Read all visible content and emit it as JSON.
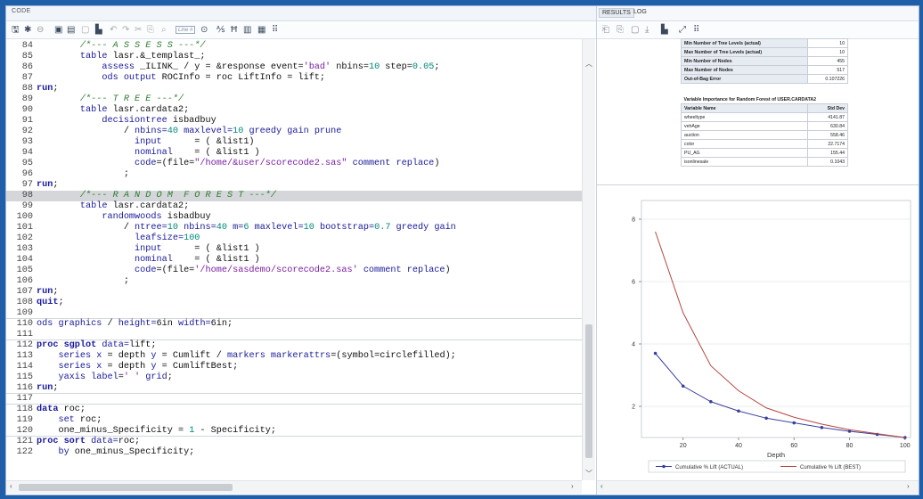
{
  "code_panel": {
    "tab_label": "CODE",
    "toolbar_icons": [
      "save-icon",
      "save-as-icon",
      "copy-icon",
      "print-icon",
      "undo-icon",
      "redo-icon",
      "run-icon",
      "stop-icon",
      "format-icon",
      "snippets-icon",
      "settings-icon"
    ],
    "line_box_label": "Line #",
    "lines": [
      {
        "n": "84",
        "t": [
          [
            "cm",
            "        /*--- A S S E S S ---*/"
          ]
        ]
      },
      {
        "n": "85",
        "t": [
          [
            "kw2",
            "        table "
          ],
          [
            "txt",
            "lasr.&_templast_;"
          ]
        ]
      },
      {
        "n": "86",
        "t": [
          [
            "kw2",
            "            assess "
          ],
          [
            "txt",
            "_ILINK_ / y = &response event="
          ],
          [
            "str",
            "'bad'"
          ],
          [
            "txt",
            " nbins="
          ],
          [
            "num",
            "10"
          ],
          [
            "txt",
            " step="
          ],
          [
            "num",
            "0.05"
          ],
          [
            "txt",
            ";"
          ]
        ]
      },
      {
        "n": "87",
        "t": [
          [
            "kw2",
            "            ods output "
          ],
          [
            "txt",
            "ROCInfo = roc LiftInfo = lift;"
          ]
        ]
      },
      {
        "n": "88",
        "t": [
          [
            "kw",
            "run"
          ],
          [
            "txt",
            ";"
          ]
        ]
      },
      {
        "n": "89",
        "t": [
          [
            "cm",
            "        /*--- T R E E ---*/"
          ]
        ]
      },
      {
        "n": "90",
        "t": [
          [
            "kw2",
            "        table "
          ],
          [
            "txt",
            "lasr.cardata2;"
          ]
        ]
      },
      {
        "n": "91",
        "t": [
          [
            "kw2",
            "            decisiontree "
          ],
          [
            "txt",
            "isbadbuy"
          ]
        ]
      },
      {
        "n": "92",
        "t": [
          [
            "txt",
            "                / "
          ],
          [
            "kw2",
            "nbins="
          ],
          [
            "num",
            "40"
          ],
          [
            "kw2",
            " maxlevel="
          ],
          [
            "num",
            "10"
          ],
          [
            "kw2",
            " greedy gain prune"
          ]
        ]
      },
      {
        "n": "93",
        "t": [
          [
            "kw2",
            "                  input      "
          ],
          [
            "txt",
            "= ( &list1)"
          ]
        ]
      },
      {
        "n": "94",
        "t": [
          [
            "kw2",
            "                  nominal    "
          ],
          [
            "txt",
            "= ( &list1 )"
          ]
        ]
      },
      {
        "n": "95",
        "t": [
          [
            "kw2",
            "                  code"
          ],
          [
            "txt",
            "=(file="
          ],
          [
            "str",
            "\"/home/&user/scorecode2.sas\""
          ],
          [
            "kw2",
            " comment replace"
          ],
          [
            "txt",
            ")"
          ]
        ]
      },
      {
        "n": "96",
        "t": [
          [
            "txt",
            "                ;"
          ]
        ]
      },
      {
        "n": "97",
        "t": [
          [
            "kw",
            "run"
          ],
          [
            "txt",
            ";"
          ]
        ]
      },
      {
        "n": "98",
        "t": [
          [
            "cm",
            "        /*--- R A N D O M  F O R E S T ---*/"
          ]
        ],
        "hl": true
      },
      {
        "n": "99",
        "t": [
          [
            "kw2",
            "        table "
          ],
          [
            "txt",
            "lasr.cardata2;"
          ]
        ]
      },
      {
        "n": "100",
        "t": [
          [
            "kw2",
            "            randomwoods "
          ],
          [
            "txt",
            "isbadbuy"
          ]
        ]
      },
      {
        "n": "101",
        "t": [
          [
            "txt",
            "                / "
          ],
          [
            "kw2",
            "ntree="
          ],
          [
            "num",
            "10"
          ],
          [
            "kw2",
            " nbins="
          ],
          [
            "num",
            "40"
          ],
          [
            "kw2",
            " m="
          ],
          [
            "num",
            "6"
          ],
          [
            "kw2",
            " maxlevel="
          ],
          [
            "num",
            "10"
          ],
          [
            "kw2",
            " bootstrap="
          ],
          [
            "num",
            "0.7"
          ],
          [
            "kw2",
            " greedy gain"
          ]
        ]
      },
      {
        "n": "102",
        "t": [
          [
            "kw2",
            "                  leafsize="
          ],
          [
            "num",
            "100"
          ]
        ]
      },
      {
        "n": "103",
        "t": [
          [
            "kw2",
            "                  input      "
          ],
          [
            "txt",
            "= ( &list1 )"
          ]
        ]
      },
      {
        "n": "104",
        "t": [
          [
            "kw2",
            "                  nominal    "
          ],
          [
            "txt",
            "= ( &list1 )"
          ]
        ]
      },
      {
        "n": "105",
        "t": [
          [
            "kw2",
            "                  code"
          ],
          [
            "txt",
            "=(file="
          ],
          [
            "str",
            "'/home/sasdemo/scorecode2.sas'"
          ],
          [
            "kw2",
            " comment replace"
          ],
          [
            "txt",
            ")"
          ]
        ]
      },
      {
        "n": "106",
        "t": [
          [
            "txt",
            "                ;"
          ]
        ]
      },
      {
        "n": "107",
        "t": [
          [
            "kw",
            "run"
          ],
          [
            "txt",
            ";"
          ]
        ]
      },
      {
        "n": "108",
        "t": [
          [
            "kw",
            "quit"
          ],
          [
            "txt",
            ";"
          ]
        ]
      },
      {
        "n": "109",
        "t": [
          [
            "txt",
            ""
          ]
        ]
      },
      {
        "n": "110",
        "t": [
          [
            "kw2",
            "ods graphics "
          ],
          [
            "txt",
            "/ "
          ],
          [
            "kw2",
            "height="
          ],
          [
            "txt",
            "6in "
          ],
          [
            "kw2",
            "width="
          ],
          [
            "txt",
            "6in;"
          ]
        ],
        "sep_before": true
      },
      {
        "n": "111",
        "t": [
          [
            "txt",
            ""
          ]
        ]
      },
      {
        "n": "112",
        "t": [
          [
            "kw",
            "proc sgplot "
          ],
          [
            "kw2",
            "data="
          ],
          [
            "txt",
            "lift;"
          ]
        ],
        "sep_before": true
      },
      {
        "n": "113",
        "t": [
          [
            "kw2",
            "    series x "
          ],
          [
            "txt",
            "= depth "
          ],
          [
            "kw2",
            "y "
          ],
          [
            "txt",
            "= Cumlift / "
          ],
          [
            "kw2",
            "markers markerattrs"
          ],
          [
            "txt",
            "=(symbol=circlefilled);"
          ]
        ]
      },
      {
        "n": "114",
        "t": [
          [
            "kw2",
            "    series x "
          ],
          [
            "txt",
            "= depth "
          ],
          [
            "kw2",
            "y "
          ],
          [
            "txt",
            "= CumliftBest;"
          ]
        ]
      },
      {
        "n": "115",
        "t": [
          [
            "kw2",
            "    yaxis label"
          ],
          [
            "txt",
            "="
          ],
          [
            "str",
            "' '"
          ],
          [
            "kw2",
            " grid"
          ],
          [
            "txt",
            ";"
          ]
        ]
      },
      {
        "n": "116",
        "t": [
          [
            "kw",
            "run"
          ],
          [
            "txt",
            ";"
          ]
        ]
      },
      {
        "n": "117",
        "t": [
          [
            "txt",
            ""
          ]
        ],
        "sep_before": true
      },
      {
        "n": "118",
        "t": [
          [
            "kw",
            "data "
          ],
          [
            "txt",
            "roc;"
          ]
        ],
        "sep_before": true
      },
      {
        "n": "119",
        "t": [
          [
            "kw2",
            "    set "
          ],
          [
            "txt",
            "roc;"
          ]
        ]
      },
      {
        "n": "120",
        "t": [
          [
            "txt",
            "    one_minus_Specificity = "
          ],
          [
            "num",
            "1"
          ],
          [
            "txt",
            " - Specificity;"
          ]
        ]
      },
      {
        "n": "121",
        "t": [
          [
            "kw",
            "proc sort "
          ],
          [
            "kw2",
            "data="
          ],
          [
            "txt",
            "roc;"
          ]
        ],
        "sep_before": true
      },
      {
        "n": "122",
        "t": [
          [
            "kw2",
            "    by "
          ],
          [
            "txt",
            "one_minus_Specificity;"
          ]
        ]
      }
    ]
  },
  "results_panel": {
    "tabs": [
      {
        "label": "RESULTS",
        "active": true
      },
      {
        "label": "LOG",
        "active": false
      }
    ],
    "toolbar_icons": [
      "back-icon",
      "forward-icon",
      "open-icon",
      "download-icon",
      "print-icon",
      "expand-icon",
      "settings-icon"
    ],
    "model_table": [
      {
        "label": "Min Number of Tree Levels (actual)",
        "value": "10"
      },
      {
        "label": "Max Number of Tree Levels (actual)",
        "value": "10"
      },
      {
        "label": "Min Number of Nodes",
        "value": "455"
      },
      {
        "label": "Max Number of Nodes",
        "value": "517"
      },
      {
        "label": "Out-of-Bag Error",
        "value": "0.107226"
      }
    ],
    "importance_table": {
      "caption": "Variable Importance for Random Forest of USER.CARDATA2",
      "headers": [
        "Variable Name",
        "Std Dev"
      ],
      "rows": [
        [
          "wheeltype",
          "4141.87"
        ],
        [
          "vehAge",
          "630.84"
        ],
        [
          "auction",
          "558.46"
        ],
        [
          "color",
          "22.7174"
        ],
        [
          "PU_AG",
          "155.44"
        ],
        [
          "isonlinesale",
          "0.1043"
        ]
      ]
    }
  },
  "chart_data": {
    "type": "line",
    "xlabel": "Depth",
    "ylabel": "",
    "xlim": [
      5,
      102
    ],
    "ylim": [
      1,
      8.6
    ],
    "xticks": [
      20,
      40,
      60,
      80,
      100
    ],
    "yticks": [
      2,
      4,
      6,
      8
    ],
    "grid": true,
    "legend_position": "bottom",
    "series": [
      {
        "name": "Cumulative % Lift (ACTUAL)",
        "color": "#3a3f9e",
        "markers": true,
        "x": [
          10,
          20,
          30,
          40,
          50,
          60,
          70,
          80,
          90,
          100
        ],
        "y": [
          3.7,
          2.65,
          2.15,
          1.85,
          1.62,
          1.47,
          1.32,
          1.2,
          1.1,
          1.0
        ]
      },
      {
        "name": "Cumulative % Lift (BEST)",
        "color": "#b5473f",
        "markers": false,
        "x": [
          10,
          20,
          30,
          40,
          50,
          60,
          70,
          80,
          90,
          100
        ],
        "y": [
          7.6,
          5.0,
          3.3,
          2.5,
          1.95,
          1.65,
          1.43,
          1.25,
          1.12,
          1.0
        ]
      }
    ]
  }
}
